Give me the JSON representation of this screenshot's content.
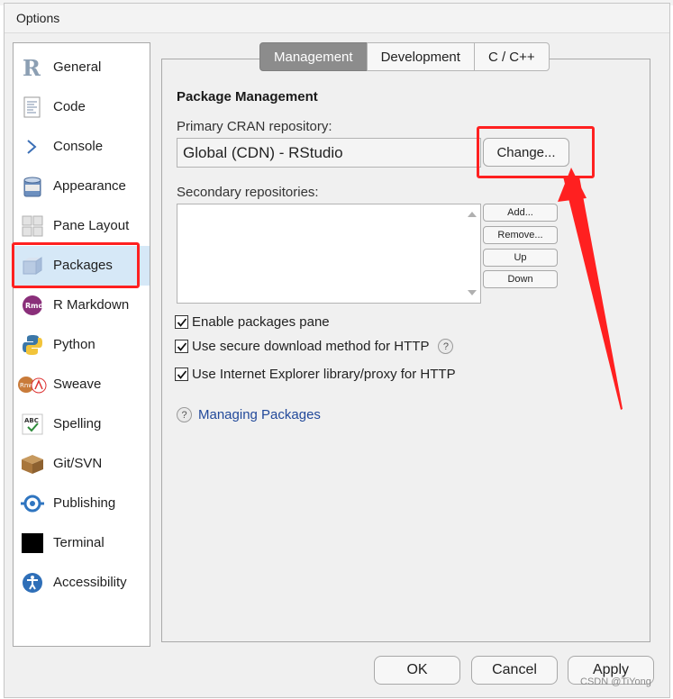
{
  "window": {
    "title": "Options"
  },
  "sidebar": {
    "items": [
      {
        "label": "General",
        "icon": "r-logo-icon"
      },
      {
        "label": "Code",
        "icon": "code-icon"
      },
      {
        "label": "Console",
        "icon": "console-icon"
      },
      {
        "label": "Appearance",
        "icon": "appearance-icon"
      },
      {
        "label": "Pane Layout",
        "icon": "pane-layout-icon"
      },
      {
        "label": "Packages",
        "icon": "packages-icon",
        "selected": true
      },
      {
        "label": "R Markdown",
        "icon": "rmarkdown-icon"
      },
      {
        "label": "Python",
        "icon": "python-icon"
      },
      {
        "label": "Sweave",
        "icon": "sweave-icon"
      },
      {
        "label": "Spelling",
        "icon": "spelling-icon"
      },
      {
        "label": "Git/SVN",
        "icon": "git-icon"
      },
      {
        "label": "Publishing",
        "icon": "publishing-icon"
      },
      {
        "label": "Terminal",
        "icon": "terminal-icon"
      },
      {
        "label": "Accessibility",
        "icon": "accessibility-icon"
      }
    ]
  },
  "tabs": [
    {
      "label": "Management",
      "active": true
    },
    {
      "label": "Development",
      "active": false
    },
    {
      "label": "C / C++",
      "active": false
    }
  ],
  "management": {
    "heading": "Package Management",
    "primary_label": "Primary CRAN repository:",
    "primary_value": "Global (CDN) - RStudio",
    "change_button": "Change...",
    "secondary_label": "Secondary repositories:",
    "secondary_buttons": {
      "add": "Add...",
      "remove": "Remove...",
      "up": "Up",
      "down": "Down"
    },
    "options": [
      {
        "label": "Enable packages pane",
        "checked": true,
        "help": false
      },
      {
        "label": "Use secure download method for HTTP",
        "checked": true,
        "help": true
      },
      {
        "label": "Use Internet Explorer library/proxy for HTTP",
        "checked": true,
        "help": false
      }
    ],
    "help_link": "Managing Packages"
  },
  "footer": {
    "ok": "OK",
    "cancel": "Cancel",
    "apply": "Apply"
  },
  "watermark": "CSDN @TiYong",
  "colors": {
    "selected_bg": "#d6e8f7",
    "active_tab": "#8c8c8c",
    "link": "#22499a",
    "annotation": "#ff2020"
  }
}
